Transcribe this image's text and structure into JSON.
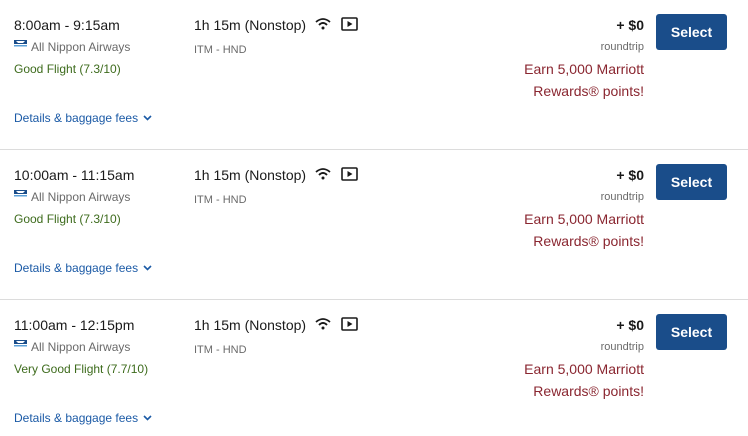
{
  "flights": [
    {
      "times": "8:00am - 9:15am",
      "airline": "All Nippon Airways",
      "rating": "Good Flight (7.3/10)",
      "duration": "1h 15m (Nonstop)",
      "route": "ITM - HND",
      "price": "+ $0",
      "trip_type": "roundtrip",
      "earn_line1": "Earn 5,000 Marriott",
      "earn_line2": "Rewards® points!",
      "select_label": "Select",
      "details_label": "Details & baggage fees"
    },
    {
      "times": "10:00am - 11:15am",
      "airline": "All Nippon Airways",
      "rating": "Good Flight (7.3/10)",
      "duration": "1h 15m (Nonstop)",
      "route": "ITM - HND",
      "price": "+ $0",
      "trip_type": "roundtrip",
      "earn_line1": "Earn 5,000 Marriott",
      "earn_line2": "Rewards® points!",
      "select_label": "Select",
      "details_label": "Details & baggage fees"
    },
    {
      "times": "11:00am - 12:15pm",
      "airline": "All Nippon Airways",
      "rating": "Very Good Flight (7.7/10)",
      "duration": "1h 15m (Nonstop)",
      "route": "ITM - HND",
      "price": "+ $0",
      "trip_type": "roundtrip",
      "earn_line1": "Earn 5,000 Marriott",
      "earn_line2": "Rewards® points!",
      "select_label": "Select",
      "details_label": "Details & baggage fees"
    }
  ],
  "icons": {
    "wifi": "wifi-icon",
    "entertainment": "video-icon",
    "airline_logo": "ana-logo",
    "chevron": "chevron-down-icon"
  },
  "colors": {
    "select_button": "#1a4d8a",
    "rating_text": "#3d6b1c",
    "rewards_text": "#8a2630",
    "link_text": "#1b5aa6"
  }
}
